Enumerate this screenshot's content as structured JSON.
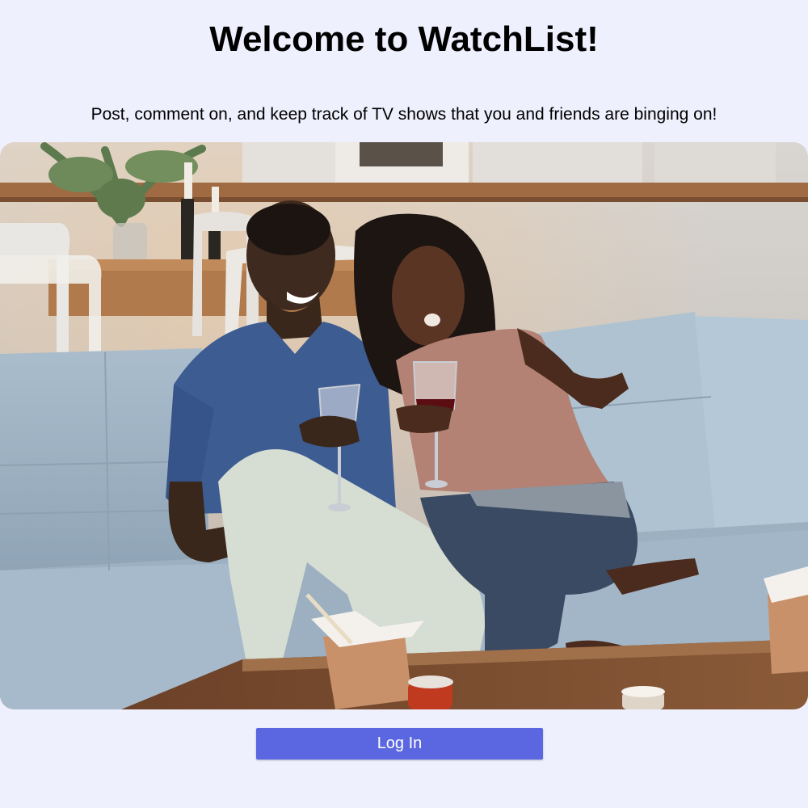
{
  "header": {
    "title": "Welcome to WatchList!",
    "subtitle": "Post, comment on, and keep track of TV shows that you and friends are binging on!"
  },
  "hero": {
    "image": "couple-watching-tv-photo"
  },
  "actions": {
    "login_label": "Log In"
  },
  "colors": {
    "background": "#eff0fe",
    "button": "#5b67e0",
    "button_text": "#ffffff"
  }
}
